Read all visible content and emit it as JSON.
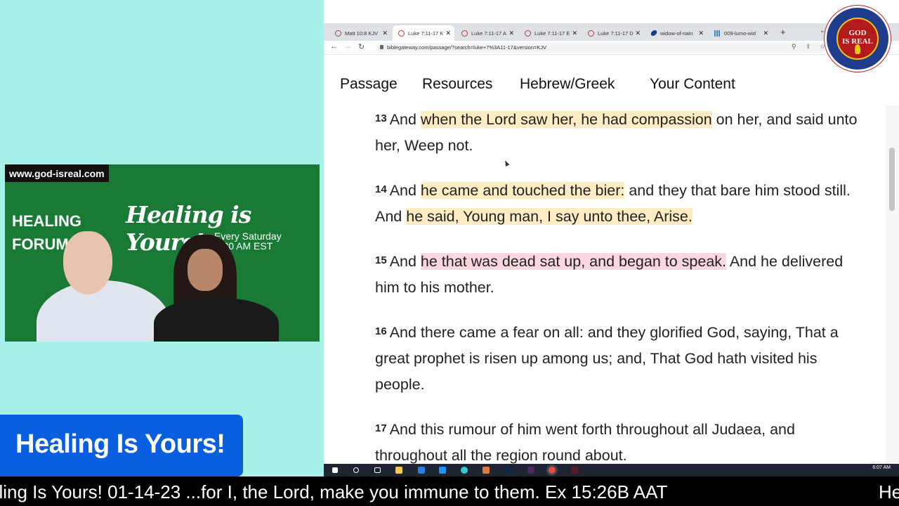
{
  "browser": {
    "tabs": [
      {
        "label": "Matt 10:8 KJV",
        "icon": "bible-gateway-icon"
      },
      {
        "label": "Luke 7:11-17 K",
        "icon": "bible-gateway-icon",
        "active": true
      },
      {
        "label": "Luke 7:11-17 A",
        "icon": "bible-gateway-icon"
      },
      {
        "label": "Luke 7:11-17 E",
        "icon": "bible-gateway-icon"
      },
      {
        "label": "Luke 7:11-17 D",
        "icon": "bible-gateway-icon"
      },
      {
        "label": "widow-of-nain",
        "icon": "feather-icon"
      },
      {
        "label": "009-lumo-wid",
        "icon": "grid-icon"
      }
    ],
    "new_tab": "+",
    "url": "biblegateway.com/passage/?search=luke+7%3A11-17&version=KJV",
    "nav": [
      "Passage",
      "Resources",
      "Hebrew/Greek",
      "Your Content"
    ]
  },
  "passage": {
    "verses": [
      {
        "num": "13",
        "segments": [
          {
            "text": "And "
          },
          {
            "text": "when the Lord saw her, he had compassion",
            "hl": "y"
          },
          {
            "text": " on her, and said unto her, Weep not."
          }
        ]
      },
      {
        "num": "14",
        "segments": [
          {
            "text": "And "
          },
          {
            "text": "he came and touched the bier:",
            "hl": "y"
          },
          {
            "text": " and they that bare him stood still. And "
          },
          {
            "text": "he said, Young man, I say unto thee, Arise.",
            "hl": "y"
          }
        ]
      },
      {
        "num": "15",
        "segments": [
          {
            "text": "And "
          },
          {
            "text": "he that was dead sat up, and began to speak.",
            "hl": "p"
          },
          {
            "text": " And he delivered him to his mother."
          }
        ]
      },
      {
        "num": "16",
        "segments": [
          {
            "text": "And there came a fear on all: and they glorified God, saying, That a great prophet is risen up among us; and, That God hath visited his people."
          }
        ]
      },
      {
        "num": "17",
        "segments": [
          {
            "text": "And this rumour of him went forth throughout all Judaea, and throughout all the region round about."
          }
        ]
      }
    ]
  },
  "logo": {
    "text_line1": "GOD",
    "text_line2": "IS REAL"
  },
  "video": {
    "url": "www.god-isreal.com",
    "forum_line1": "HEALING",
    "forum_line2": "FORUM",
    "title": "Healing is Yours!",
    "schedule_line1": "Every Saturday",
    "schedule_line2": "30 AM EST"
  },
  "lower_third": "Healing Is Yours!",
  "taskbar": {
    "clock": "6:07 AM"
  },
  "ticker": {
    "text": "aling Is Yours! 01-14-23 ...for I, the Lord, make you immune to them. Ex 15:26B AAT",
    "repeat": "He"
  },
  "colors": {
    "highlight_yellow": "#fdebc4",
    "highlight_pink": "#fad7df",
    "video_bg": "#197a35",
    "lower_third": "#0a5fe0"
  }
}
